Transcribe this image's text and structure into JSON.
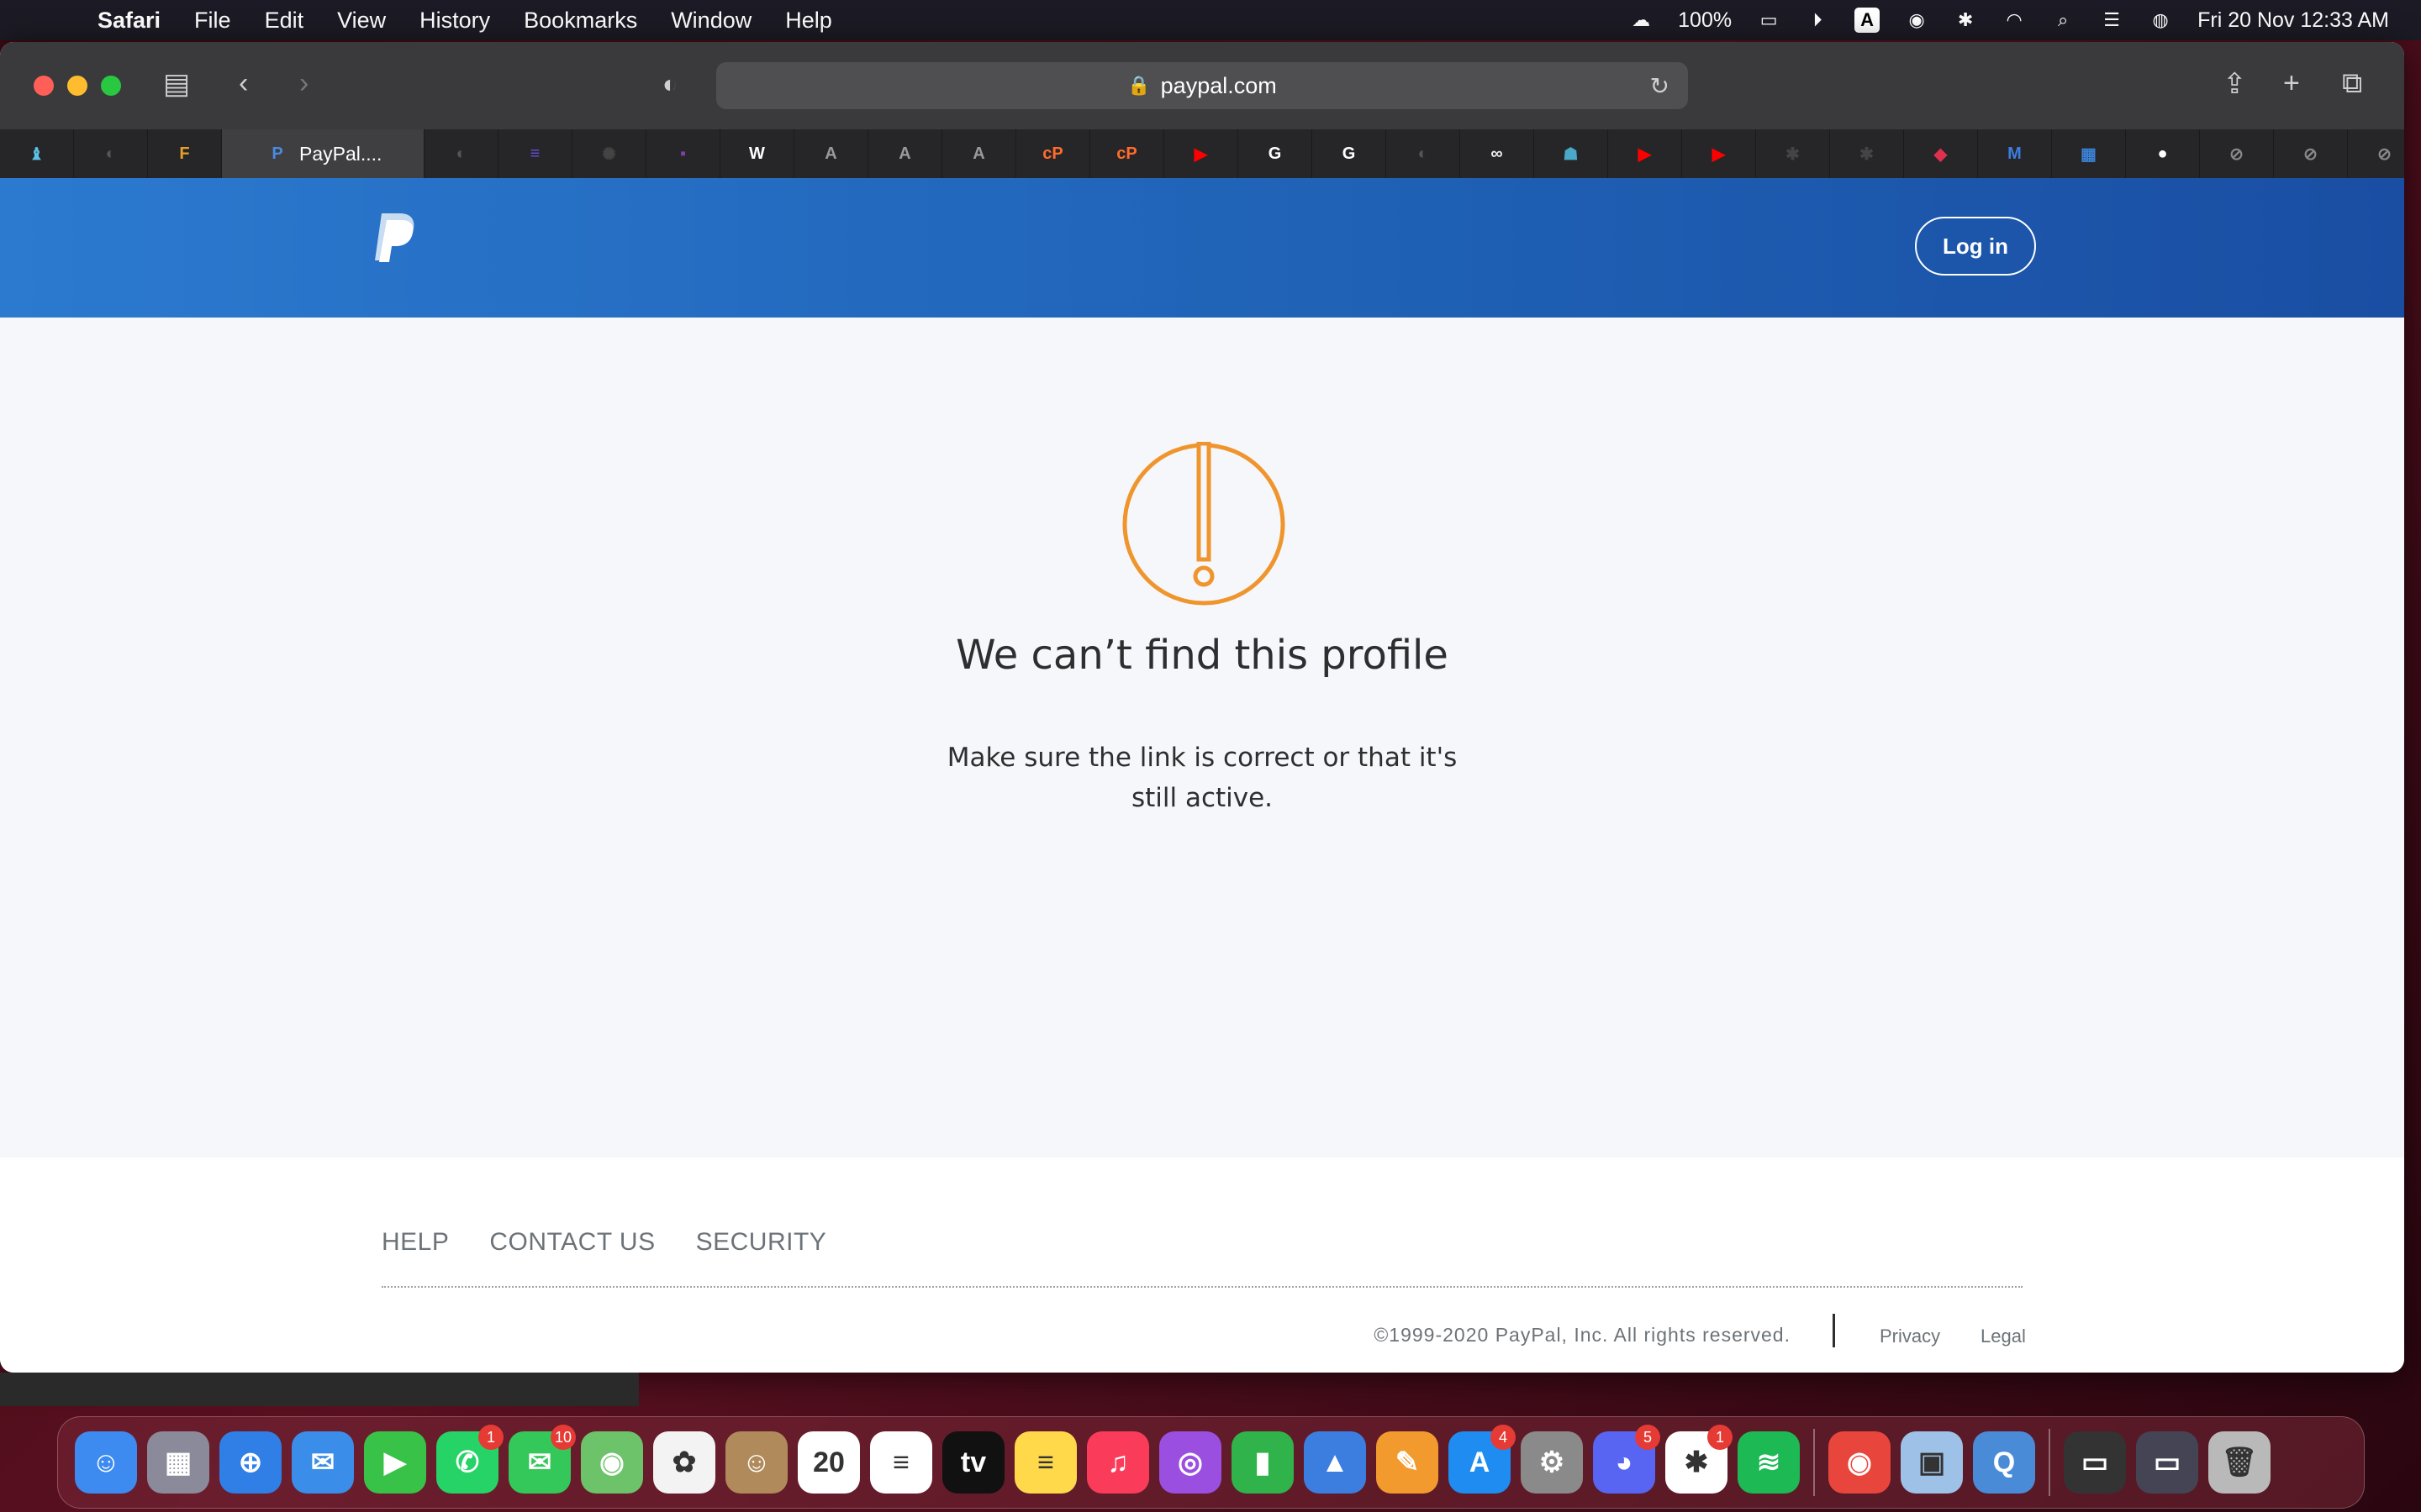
{
  "menubar": {
    "app": "Safari",
    "items": [
      "File",
      "Edit",
      "View",
      "History",
      "Bookmarks",
      "Window",
      "Help"
    ],
    "battery": "100%",
    "input_letter": "A",
    "datetime": "Fri 20 Nov  12:33 AM"
  },
  "browser": {
    "url": "paypal.com",
    "active_tab": "PayPal....",
    "tab_favicons": [
      {
        "icon": "chess-icon",
        "color": "#5cc2e6",
        "glyph": "♝"
      },
      {
        "icon": "chat-bubble-icon",
        "color": "#555",
        "glyph": "◐"
      },
      {
        "icon": "ff-icon",
        "color": "#e8a02a",
        "glyph": "F"
      },
      {
        "icon": "chat-bubble-icon",
        "color": "#555",
        "glyph": "◐"
      },
      {
        "icon": "list-icon",
        "color": "#6a4fd8",
        "glyph": "≡"
      },
      {
        "icon": "colorful-dots-icon",
        "color": "#444",
        "glyph": "✺"
      },
      {
        "icon": "purple-square-icon",
        "color": "#7b3fa8",
        "glyph": "▪"
      },
      {
        "icon": "wikipedia-icon",
        "color": "#fff",
        "glyph": "W"
      },
      {
        "icon": "letter-a-icon",
        "color": "#9a9a9a",
        "glyph": "A"
      },
      {
        "icon": "letter-a-icon",
        "color": "#9a9a9a",
        "glyph": "A"
      },
      {
        "icon": "letter-a-icon",
        "color": "#9a9a9a",
        "glyph": "A"
      },
      {
        "icon": "cpanel-icon",
        "color": "#ff6c2c",
        "glyph": "cP"
      },
      {
        "icon": "cpanel-icon",
        "color": "#ff6c2c",
        "glyph": "cP"
      },
      {
        "icon": "youtube-icon",
        "color": "#ff0000",
        "glyph": "▶"
      },
      {
        "icon": "google-icon",
        "color": "#fff",
        "glyph": "G"
      },
      {
        "icon": "google-icon",
        "color": "#fff",
        "glyph": "G"
      },
      {
        "icon": "chat-bubble-icon",
        "color": "#555",
        "glyph": "◐"
      },
      {
        "icon": "infinity-icon",
        "color": "#eee",
        "glyph": "∞"
      },
      {
        "icon": "figure-icon",
        "color": "#4aa8c8",
        "glyph": "☗"
      },
      {
        "icon": "youtube-icon",
        "color": "#ff0000",
        "glyph": "▶"
      },
      {
        "icon": "youtube-icon",
        "color": "#ff0000",
        "glyph": "▶"
      },
      {
        "icon": "slack-icon",
        "color": "#444",
        "glyph": "✱"
      },
      {
        "icon": "slack-icon",
        "color": "#444",
        "glyph": "✱"
      },
      {
        "icon": "box-icon",
        "color": "#e0304e",
        "glyph": "◆"
      },
      {
        "icon": "m-logo-icon",
        "color": "#3d7de0",
        "glyph": "M"
      },
      {
        "icon": "calculator-icon",
        "color": "#3b82d6",
        "glyph": "▦"
      },
      {
        "icon": "github-icon",
        "color": "#fff",
        "glyph": "●"
      },
      {
        "icon": "compass-icon",
        "color": "#888",
        "glyph": "⊘"
      },
      {
        "icon": "compass-icon",
        "color": "#888",
        "glyph": "⊘"
      },
      {
        "icon": "compass-icon",
        "color": "#888",
        "glyph": "⊘"
      }
    ]
  },
  "page": {
    "login_label": "Log in",
    "error_title": "We can’t find this profile",
    "error_message": "Make sure the link is correct or that it's still active.",
    "footer_links": [
      "HELP",
      "CONTACT US",
      "SECURITY"
    ],
    "copyright": "©1999-2020 PayPal, Inc. All rights reserved.",
    "privacy": "Privacy",
    "legal": "Legal",
    "colors": {
      "header": "#1f62b6",
      "warning": "#f0952e"
    }
  },
  "dock": {
    "items": [
      {
        "icon": "finder-icon",
        "color": "#3d8bf0",
        "glyph": "☺",
        "badge": ""
      },
      {
        "icon": "launchpad-icon",
        "color": "#8a8a9a",
        "glyph": "▦",
        "badge": ""
      },
      {
        "icon": "safari-icon",
        "color": "#2f7fe6",
        "glyph": "⊕",
        "badge": ""
      },
      {
        "icon": "mail-icon",
        "color": "#3a8de8",
        "glyph": "✉",
        "badge": ""
      },
      {
        "icon": "facetime-icon",
        "color": "#38c248",
        "glyph": "▶",
        "badge": ""
      },
      {
        "icon": "whatsapp-icon",
        "color": "#25d366",
        "glyph": "✆",
        "badge": "1"
      },
      {
        "icon": "messages-icon",
        "color": "#34c759",
        "glyph": "✉",
        "badge": "10"
      },
      {
        "icon": "maps-icon",
        "color": "#6cc36a",
        "glyph": "◉",
        "badge": ""
      },
      {
        "icon": "photos-icon",
        "color": "#f3f3f3",
        "glyph": "✿",
        "badge": ""
      },
      {
        "icon": "contacts-icon",
        "color": "#b08a5a",
        "glyph": "☺",
        "badge": ""
      },
      {
        "icon": "calendar-icon",
        "color": "#ffffff",
        "glyph": "20",
        "badge": ""
      },
      {
        "icon": "reminders-icon",
        "color": "#ffffff",
        "glyph": "≡",
        "badge": ""
      },
      {
        "icon": "apple-tv-icon",
        "color": "#111111",
        "glyph": "tv",
        "badge": ""
      },
      {
        "icon": "notes-icon",
        "color": "#ffd94a",
        "glyph": "≡",
        "badge": ""
      },
      {
        "icon": "music-icon",
        "color": "#fa3c5a",
        "glyph": "♫",
        "badge": ""
      },
      {
        "icon": "podcasts-icon",
        "color": "#9b4fe0",
        "glyph": "◎",
        "badge": ""
      },
      {
        "icon": "numbers-icon",
        "color": "#2fb34a",
        "glyph": "▮",
        "badge": ""
      },
      {
        "icon": "keynote-icon",
        "color": "#3c7ee0",
        "glyph": "▲",
        "badge": ""
      },
      {
        "icon": "pages-icon",
        "color": "#f29a2e",
        "glyph": "✎",
        "badge": ""
      },
      {
        "icon": "app-store-icon",
        "color": "#1e8cf0",
        "glyph": "A",
        "badge": "4"
      },
      {
        "icon": "system-preferences-icon",
        "color": "#8a8a8a",
        "glyph": "⚙",
        "badge": ""
      },
      {
        "icon": "discord-icon",
        "color": "#5865f2",
        "glyph": "◕",
        "badge": "5"
      },
      {
        "icon": "slack-icon",
        "color": "#ffffff",
        "glyph": "✱",
        "badge": "1"
      },
      {
        "icon": "spotify-icon",
        "color": "#1db954",
        "glyph": "≋",
        "badge": ""
      },
      {
        "icon": "chrome-icon",
        "color": "#e8453c",
        "glyph": "◉",
        "badge": ""
      },
      {
        "icon": "preview-icon",
        "color": "#9ec1e8",
        "glyph": "▣",
        "badge": ""
      },
      {
        "icon": "quicktime-icon",
        "color": "#4a8bd8",
        "glyph": "Q",
        "badge": ""
      },
      {
        "icon": "window-thumbnail-icon",
        "color": "#333",
        "glyph": "▭",
        "badge": ""
      },
      {
        "icon": "window-thumbnail-icon",
        "color": "#445",
        "glyph": "▭",
        "badge": ""
      },
      {
        "icon": "trash-icon",
        "color": "#b9b9b9",
        "glyph": "🗑",
        "badge": ""
      }
    ]
  }
}
